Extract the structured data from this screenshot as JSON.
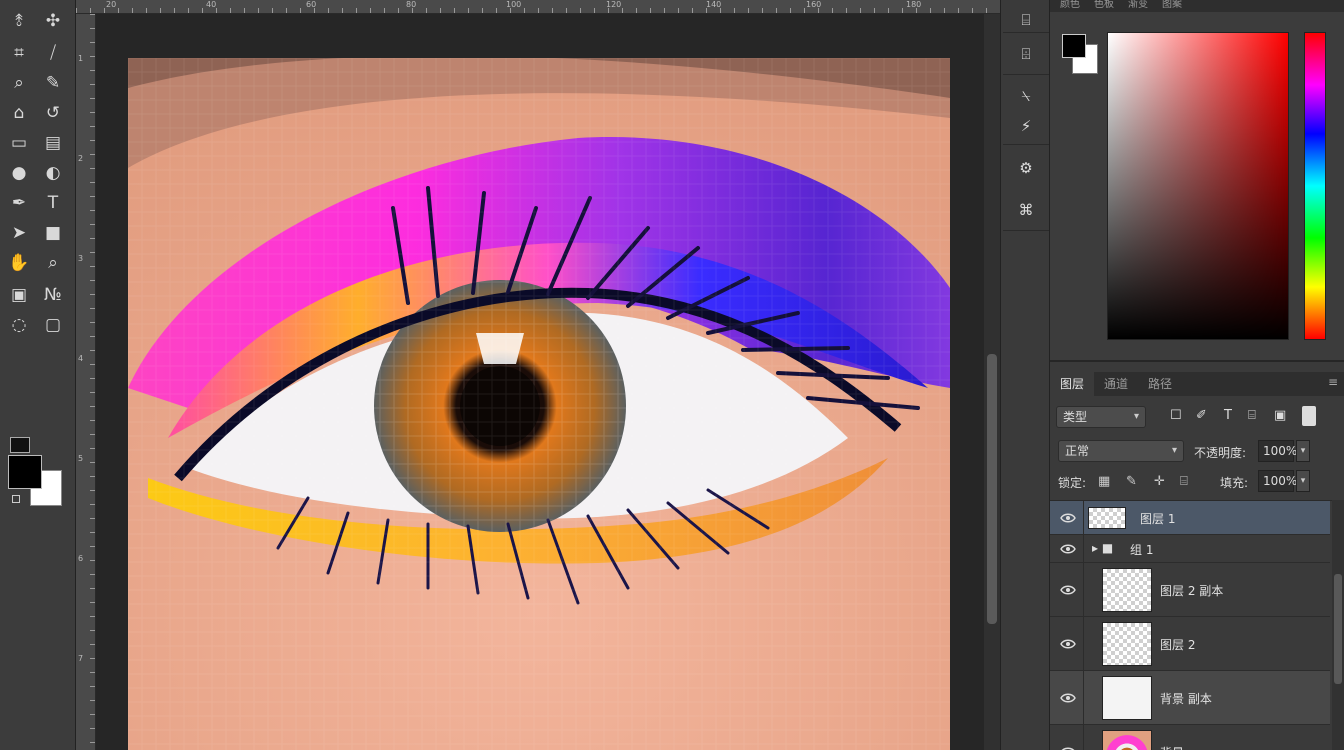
{
  "toolbar": {
    "tools": [
      {
        "icon": "lasso-icon",
        "glyph": "⥉"
      },
      {
        "icon": "move-icon",
        "glyph": "✣"
      },
      {
        "icon": "crop-icon",
        "glyph": "⌗"
      },
      {
        "icon": "eyedropper-icon",
        "glyph": "⧸"
      },
      {
        "icon": "healing-brush-icon",
        "glyph": "⌕"
      },
      {
        "icon": "brush-icon",
        "glyph": "✎"
      },
      {
        "icon": "clone-stamp-icon",
        "glyph": "⌂"
      },
      {
        "icon": "history-brush-icon",
        "glyph": "↺"
      },
      {
        "icon": "eraser-icon",
        "glyph": "▭"
      },
      {
        "icon": "gradient-icon",
        "glyph": "▤"
      },
      {
        "icon": "blur-icon",
        "glyph": "●"
      },
      {
        "icon": "dodge-icon",
        "glyph": "◐"
      },
      {
        "icon": "pen-icon",
        "glyph": "✒"
      },
      {
        "icon": "type-icon",
        "glyph": "T"
      },
      {
        "icon": "path-selection-icon",
        "glyph": "➤"
      },
      {
        "icon": "rectangle-icon",
        "glyph": "■"
      },
      {
        "icon": "hand-icon",
        "glyph": "✋"
      },
      {
        "icon": "zoom-icon",
        "glyph": "⌕"
      },
      {
        "icon": "note-icon",
        "glyph": "▣"
      },
      {
        "icon": "count-icon",
        "glyph": "№"
      },
      {
        "icon": "quick-mask-icon",
        "glyph": "◌"
      },
      {
        "icon": "screen-mode-icon",
        "glyph": "▢"
      }
    ]
  },
  "rulers": {
    "top": [
      "20",
      "40",
      "60",
      "80",
      "100",
      "120",
      "140",
      "160",
      "180"
    ],
    "left": [
      "1",
      "2",
      "3",
      "4",
      "5",
      "6",
      "7"
    ]
  },
  "strip": {
    "buttons": [
      {
        "icon": "history-icon",
        "glyph": "⌸"
      },
      {
        "icon": "properties-icon",
        "glyph": "⌹"
      },
      {
        "icon": "info-icon",
        "glyph": "⍀"
      },
      {
        "icon": "character-icon",
        "glyph": "⚡"
      },
      {
        "icon": "adjustments-icon",
        "glyph": "⚙"
      },
      {
        "icon": "styles-icon",
        "glyph": "⌘"
      }
    ]
  },
  "color_panel": {
    "tabs": [
      "颜色",
      "色板",
      "渐变",
      "图案"
    ],
    "foreground": "#000000",
    "background": "#ffffff"
  },
  "layers_panel": {
    "tabs": [
      "图层",
      "通道",
      "路径"
    ],
    "menu_glyph": "≡",
    "kind_label": "类型",
    "filter_icons": [
      "☐",
      "✐",
      "T",
      "⌸",
      "▣"
    ],
    "blend_mode": "正常",
    "opacity_label": "不透明度:",
    "opacity_value": "100%",
    "lock_label": "锁定:",
    "lock_icons": [
      "▦",
      "✎",
      "✛",
      "⌸"
    ],
    "fill_label": "填充:",
    "fill_value": "100%",
    "layers": [
      {
        "name": "图层 1",
        "kind": "pixel",
        "selected": true
      },
      {
        "name": "组 1",
        "kind": "group"
      },
      {
        "name": "图层 2 副本",
        "kind": "pixel"
      },
      {
        "name": "图层 2",
        "kind": "pixel"
      },
      {
        "name": "背景 副本",
        "kind": "white"
      },
      {
        "name": "背景",
        "kind": "photo"
      }
    ]
  }
}
